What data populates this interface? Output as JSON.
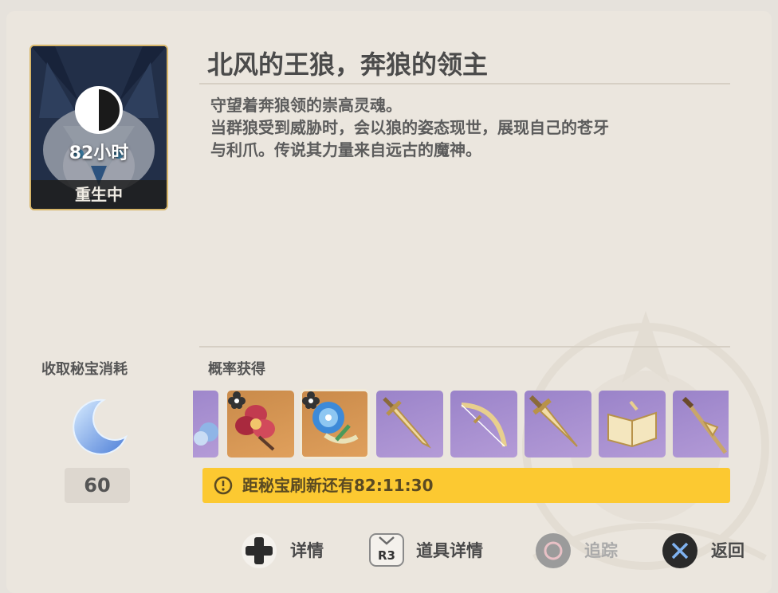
{
  "boss": {
    "title": "北风的王狼，奔狼的领主",
    "description": [
      "守望着奔狼领的崇高灵魂。",
      "当群狼受到威胁时，会以狼的姿态现世，展现自己的苍牙",
      "与利爪。传说其力量来自远古的魔神。"
    ],
    "timer": "82小时",
    "status": "重生中",
    "respawn_progress": 0.5
  },
  "cost": {
    "label": "收取秘宝消耗",
    "value": "60",
    "icon": "moon-resin-icon"
  },
  "drops": {
    "label": "概率获得",
    "items": [
      {
        "name": "partial-flower-item",
        "rarity": "purple-partial",
        "icon": "flower-icon",
        "badge": true
      },
      {
        "name": "crimson-flower-item",
        "rarity": "orange",
        "icon": "crimson-flower-icon",
        "badge": true
      },
      {
        "name": "blue-flower-item",
        "rarity": "orange",
        "icon": "blue-flower-icon",
        "badge": true,
        "selected": true
      },
      {
        "name": "sword-item",
        "rarity": "purple",
        "icon": "sword-icon"
      },
      {
        "name": "bow-item",
        "rarity": "purple",
        "icon": "bow-icon"
      },
      {
        "name": "claymore-item",
        "rarity": "purple",
        "icon": "claymore-icon"
      },
      {
        "name": "catalyst-item",
        "rarity": "purple",
        "icon": "book-icon"
      },
      {
        "name": "polearm-item",
        "rarity": "purple",
        "icon": "polearm-icon"
      }
    ]
  },
  "refresh": {
    "text": "距秘宝刷新还有82:11:30"
  },
  "hints": {
    "details": "详情",
    "r3_key": "R3",
    "item_details": "道具详情",
    "track": "追踪",
    "back": "返回"
  },
  "colors": {
    "panel": "#ebe6de",
    "banner": "#fcc931",
    "orange_rarity": "#e0a05c",
    "purple_rarity": "#b49bd7",
    "back_button": "#2a2a2a"
  }
}
